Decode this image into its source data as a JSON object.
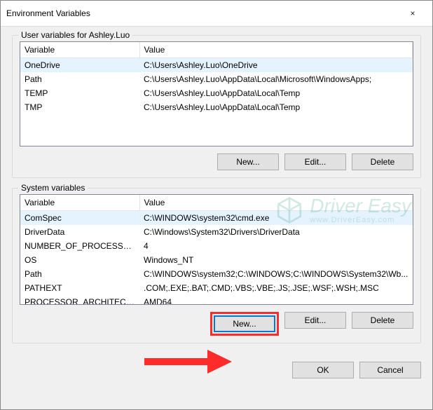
{
  "window": {
    "title": "Environment Variables",
    "close_icon": "×"
  },
  "user_section": {
    "title": "User variables for Ashley.Luo",
    "columns": {
      "variable": "Variable",
      "value": "Value"
    },
    "rows": [
      {
        "variable": "OneDrive",
        "value": "C:\\Users\\Ashley.Luo\\OneDrive"
      },
      {
        "variable": "Path",
        "value": "C:\\Users\\Ashley.Luo\\AppData\\Local\\Microsoft\\WindowsApps;"
      },
      {
        "variable": "TEMP",
        "value": "C:\\Users\\Ashley.Luo\\AppData\\Local\\Temp"
      },
      {
        "variable": "TMP",
        "value": "C:\\Users\\Ashley.Luo\\AppData\\Local\\Temp"
      }
    ],
    "buttons": {
      "new": "New...",
      "edit": "Edit...",
      "delete": "Delete"
    }
  },
  "system_section": {
    "title": "System variables",
    "columns": {
      "variable": "Variable",
      "value": "Value"
    },
    "rows": [
      {
        "variable": "ComSpec",
        "value": "C:\\WINDOWS\\system32\\cmd.exe"
      },
      {
        "variable": "DriverData",
        "value": "C:\\Windows\\System32\\Drivers\\DriverData"
      },
      {
        "variable": "NUMBER_OF_PROCESSORS",
        "value": "4"
      },
      {
        "variable": "OS",
        "value": "Windows_NT"
      },
      {
        "variable": "Path",
        "value": "C:\\WINDOWS\\system32;C:\\WINDOWS;C:\\WINDOWS\\System32\\Wb..."
      },
      {
        "variable": "PATHEXT",
        "value": ".COM;.EXE;.BAT;.CMD;.VBS;.VBE;.JS;.JSE;.WSF;.WSH;.MSC"
      },
      {
        "variable": "PROCESSOR_ARCHITECTURE",
        "value": "AMD64"
      }
    ],
    "buttons": {
      "new": "New...",
      "edit": "Edit...",
      "delete": "Delete"
    }
  },
  "dialog_buttons": {
    "ok": "OK",
    "cancel": "Cancel"
  },
  "watermark": {
    "brand": "Driver Easy",
    "url": "www.DriverEasy.com"
  }
}
